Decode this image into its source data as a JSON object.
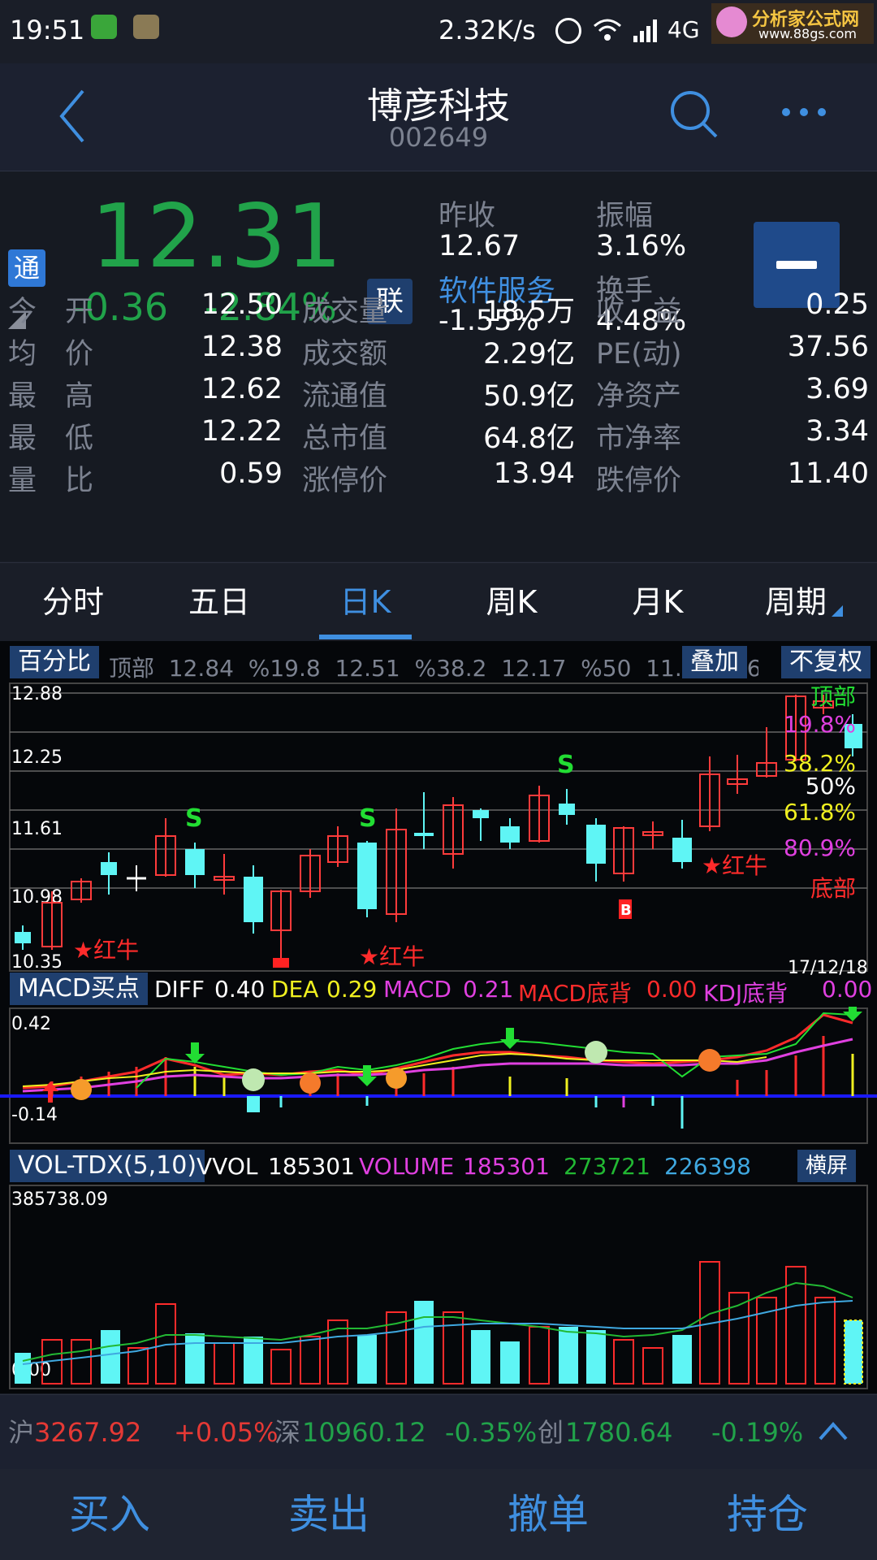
{
  "status_bar": {
    "time": "19:51",
    "speed": "2.32K/s",
    "network": "4G",
    "watermark_title": "分析家公式网",
    "watermark_url": "www.88gs.com"
  },
  "header": {
    "name": "博彦科技",
    "code": "002649"
  },
  "quote": {
    "tong_badge": "通",
    "lian_badge": "联",
    "price": "12.31",
    "change": "-0.36",
    "change_pct": "-2.84%",
    "prev_close_label": "昨收",
    "prev_close": "12.67",
    "amplitude_label": "振幅",
    "amplitude": "3.16%",
    "sector_label": "软件服务",
    "sector_change": "-1.55%",
    "turnover_label": "换手",
    "turnover": "4.48%",
    "rows": [
      {
        "l1": "今　开",
        "v1": "12.50",
        "l2": "成交量",
        "v2": "18.5万",
        "l3": "收　益",
        "v3": "0.25"
      },
      {
        "l1": "均　价",
        "v1": "12.38",
        "l2": "成交额",
        "v2": "2.29亿",
        "l3": "PE(动)",
        "v3": "37.56"
      },
      {
        "l1": "最　高",
        "v1": "12.62",
        "l2": "流通值",
        "v2": "50.9亿",
        "l3": "净资产",
        "v3": "3.69"
      },
      {
        "l1": "最　低",
        "v1": "12.22",
        "l2": "总市值",
        "v2": "64.8亿",
        "l3": "市净率",
        "v3": "3.34"
      },
      {
        "l1": "量　比",
        "v1": "0.59",
        "l2": "涨停价",
        "v2": "13.94",
        "l3": "跌停价",
        "v3": "11.40"
      }
    ]
  },
  "tabs": {
    "items": [
      "分时",
      "五日",
      "日K",
      "周K",
      "月K",
      "周期"
    ],
    "active_index": 2
  },
  "kchart": {
    "pct_button": "百分比",
    "overlay_button": "叠加",
    "adjust_button": "不复权",
    "fib_line": "顶部  12.84  %19.8  12.51  %38.2  12.17  %50  11.97  %61.8  11.7",
    "y_labels": [
      "12.88",
      "12.25",
      "11.61",
      "10.98",
      "10.35"
    ],
    "date": "17/12/18",
    "levels": [
      "顶部",
      "19.8%",
      "38.2%",
      "50%",
      "61.8%",
      "80.9%",
      "底部"
    ],
    "annotations": {
      "red_bull": "★红牛",
      "sell": "S",
      "buy": "B"
    }
  },
  "macd": {
    "button": "MACD买点",
    "diff_label": "DIFF",
    "diff": "0.40",
    "dea_label": "DEA",
    "dea": "0.29",
    "macd_label": "MACD",
    "macd": "0.21",
    "bottom_div_label": "MACD底背",
    "bottom_div": "0.00",
    "kdj_label": "KDJ底背",
    "kdj": "0.00",
    "y_top": "0.42",
    "y_bottom": "-0.14"
  },
  "volume": {
    "button": "VOL-TDX(5,10)",
    "vvol_label": "VVOL",
    "vvol": "185301",
    "volume_label": "VOLUME",
    "volume": "185301",
    "ma5": "273721",
    "ma10": "226398",
    "landscape_button": "横屏",
    "y_top": "385738.09",
    "y_bottom": "0.00"
  },
  "index_bar": {
    "sh_label": "沪",
    "sh_value": "3267.92",
    "sh_change": "+0.05%",
    "sz_label": "深",
    "sz_value": "10960.12",
    "sz_change": "-0.35%",
    "cy_label": "创",
    "cy_value": "1780.64",
    "cy_change": "-0.19%"
  },
  "trade_bar": {
    "buy": "买入",
    "sell": "卖出",
    "cancel": "撤单",
    "position": "持仓"
  },
  "colors": {
    "up": "#e53935",
    "down": "#21a34a",
    "accent": "#3f8fe0",
    "candle_up": "#ff3b3b",
    "candle_down": "#5ff5f5"
  }
}
